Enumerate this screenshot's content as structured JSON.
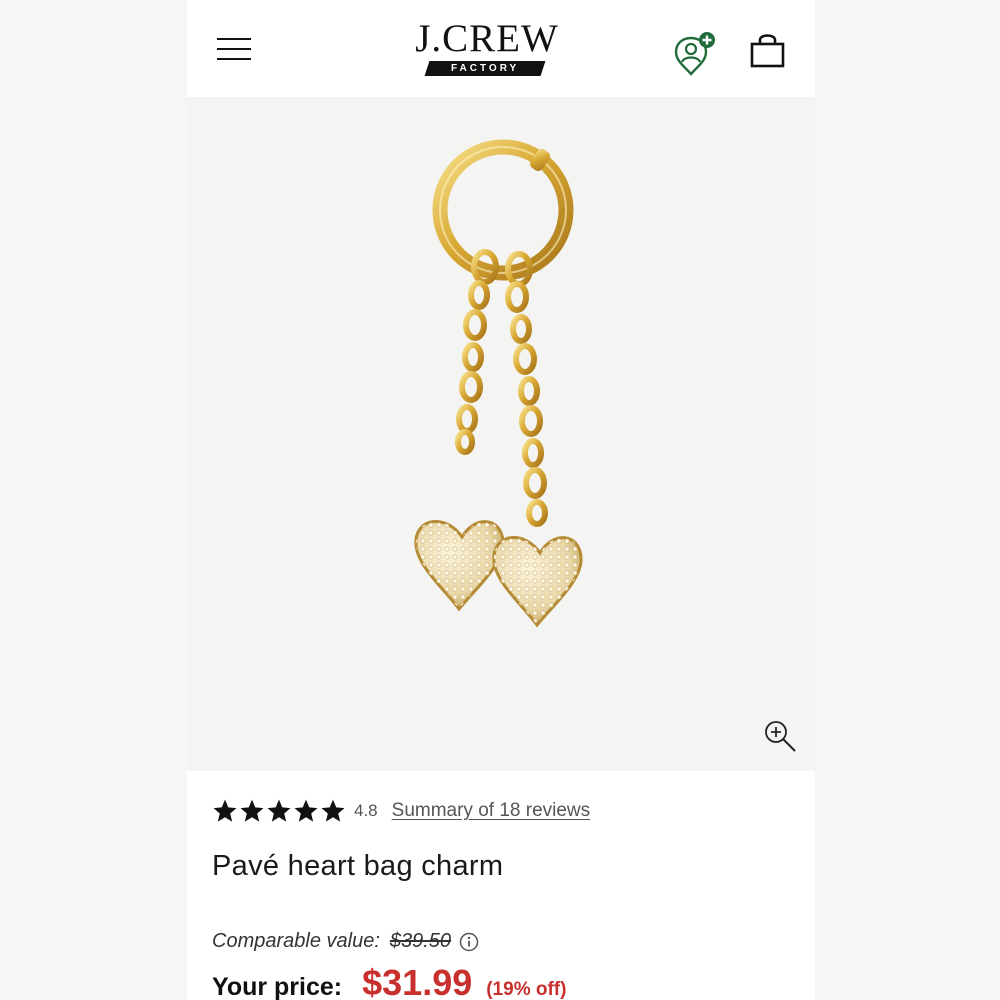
{
  "header": {
    "logo_main": "J.CREW",
    "logo_sub": "FACTORY",
    "menu_icon": "hamburger-menu-icon",
    "account_icon": "account-location-add-icon",
    "bag_icon": "shopping-bag-icon",
    "account_badge_color": "#1f6b3a"
  },
  "product_image": {
    "zoom_icon": "zoom-in-icon"
  },
  "rating": {
    "stars": 5,
    "value": "4.8",
    "reviews_link": "Summary of 18 reviews"
  },
  "product": {
    "title": "Pavé heart bag charm",
    "comparable_label": "Comparable value:",
    "comparable_value": "$39.50",
    "price_label": "Your price:",
    "price": "$31.99",
    "discount": "(19% off)",
    "price_color": "#c8302e"
  }
}
